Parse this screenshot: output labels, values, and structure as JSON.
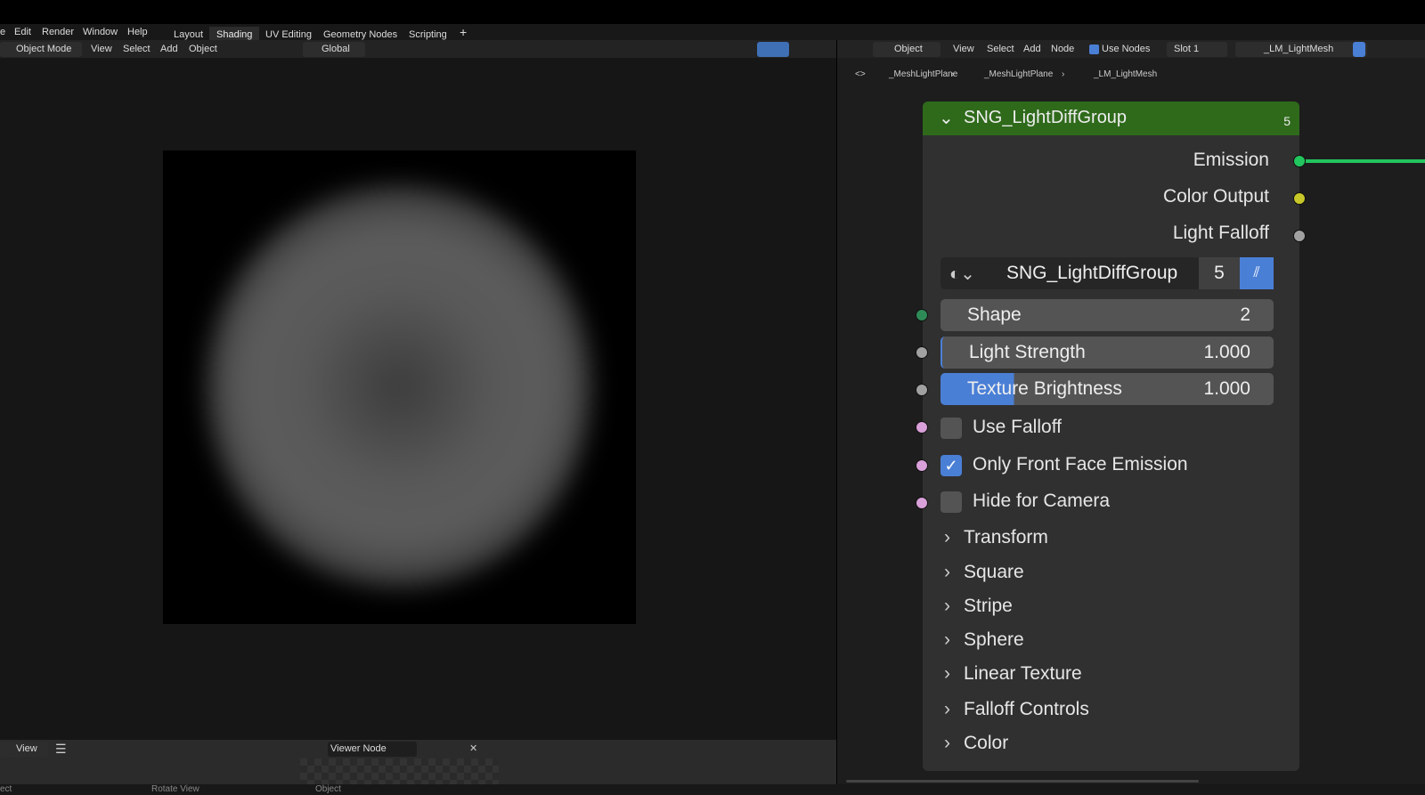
{
  "menu": {
    "items": [
      "e",
      "Edit",
      "Render",
      "Window",
      "Help"
    ],
    "workspaces": [
      "Layout",
      "Shading",
      "UV Editing",
      "Geometry Nodes",
      "Scripting",
      "+"
    ],
    "active_workspace": "Shading"
  },
  "viewport_header": {
    "mode": "Object Mode",
    "items": [
      "View",
      "Select",
      "Add",
      "Object"
    ],
    "orientation": "Global"
  },
  "node_header": {
    "type": "Object",
    "items": [
      "View",
      "Select",
      "Add",
      "Node"
    ],
    "use_nodes_label": "Use Nodes",
    "use_nodes": true,
    "slot": "Slot 1",
    "material": "_LM_LightMesh"
  },
  "breadcrumb": [
    "_MeshLightPlane",
    "_MeshLightPlane",
    "_LM_LightMesh"
  ],
  "node": {
    "title": "SNG_LightDiffGroup",
    "users": "5",
    "outputs": [
      {
        "label": "Emission",
        "color": "#22c55e"
      },
      {
        "label": "Color Output",
        "color": "#c7c729"
      },
      {
        "label": "Light Falloff",
        "color": "#a1a1a1"
      }
    ],
    "group_name": "SNG_LightDiffGroup",
    "group_users": "5",
    "inputs": [
      {
        "label": "Shape",
        "value": "2",
        "socket": "#2e8b57",
        "fill": 0
      },
      {
        "label": "Light Strength",
        "value": "1.000",
        "socket": "#a1a1a1",
        "fill": 0.005
      },
      {
        "label": "Texture Brightness",
        "value": "1.000",
        "socket": "#a1a1a1",
        "fill": 0.22
      }
    ],
    "checkboxes": [
      {
        "label": "Use Falloff",
        "checked": false
      },
      {
        "label": "Only Front Face Emission",
        "checked": true
      },
      {
        "label": "Hide for Camera",
        "checked": false
      }
    ],
    "panels": [
      "Transform",
      "Square",
      "Stripe",
      "Sphere",
      "Linear Texture",
      "Falloff Controls",
      "Color"
    ]
  },
  "image_editor": {
    "view": "View",
    "image": "Viewer Node"
  },
  "status": [
    "ect",
    "Rotate View",
    "Object"
  ]
}
